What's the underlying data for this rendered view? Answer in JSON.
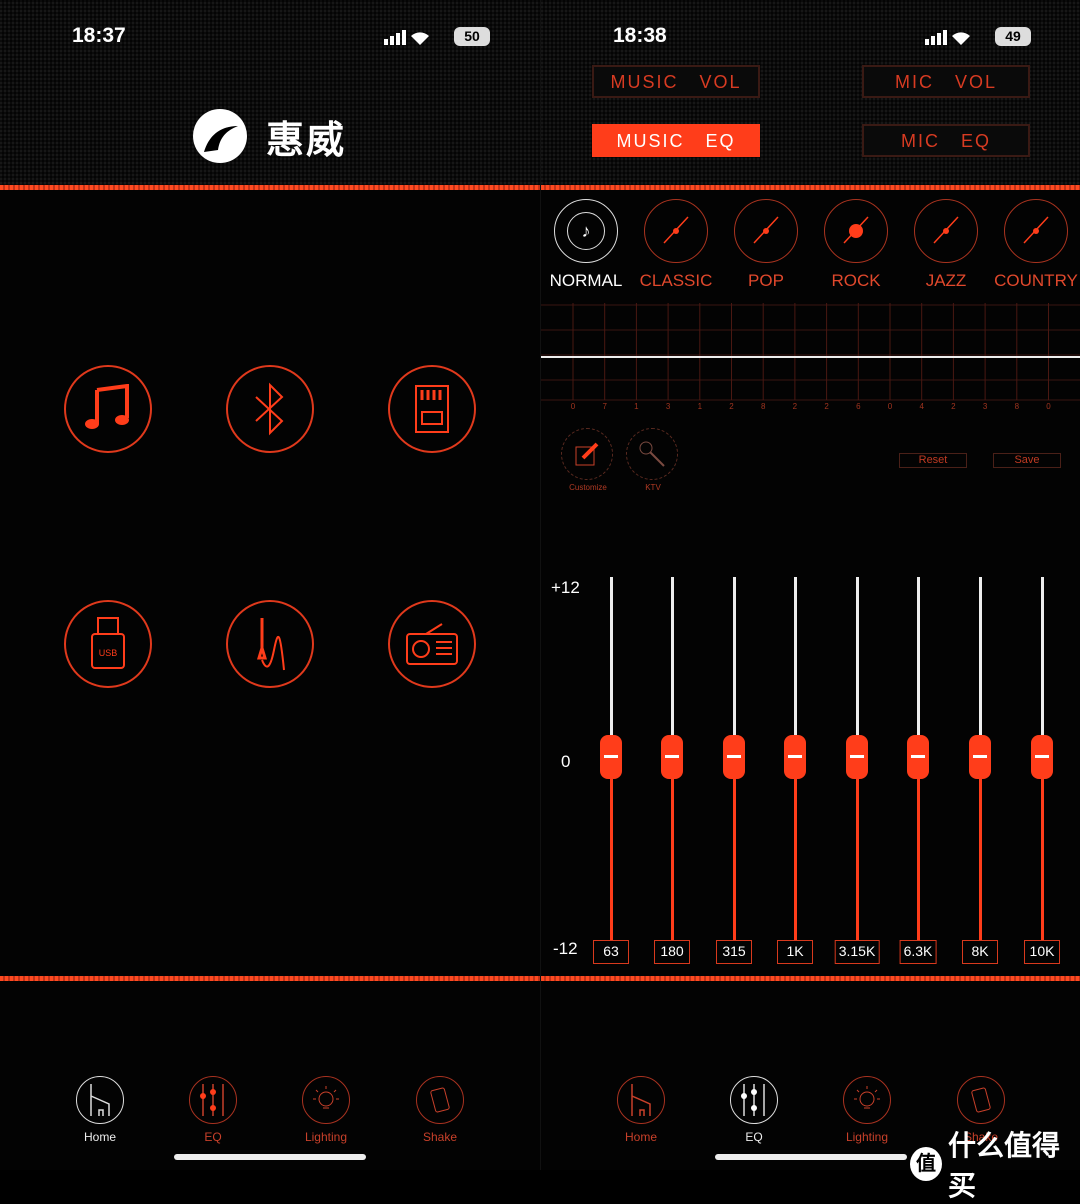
{
  "accent": "#ff3d1a",
  "left": {
    "time": "18:37",
    "battery": "50",
    "brand": "惠威",
    "sources": [
      "music-note-icon",
      "bluetooth-icon",
      "sd-card-icon",
      "usb-icon",
      "aux-cable-icon",
      "radio-icon"
    ],
    "usb_label": "USB",
    "nav": [
      {
        "label": "Home",
        "active": true
      },
      {
        "label": "EQ"
      },
      {
        "label": "Lighting"
      },
      {
        "label": "Shake"
      }
    ]
  },
  "right": {
    "time": "18:38",
    "battery": "49",
    "buttons": {
      "music_vol": "MUSIC VOL",
      "mic_vol": "MIC VOL",
      "music_eq": "MUSIC EQ",
      "mic_eq": "MIC EQ"
    },
    "presets": [
      {
        "label": "NORMAL",
        "active": true
      },
      {
        "label": "CLASSIC"
      },
      {
        "label": "POP"
      },
      {
        "label": "ROCK"
      },
      {
        "label": "JAZZ"
      },
      {
        "label": "COUNTRY"
      }
    ],
    "grid_labels": [
      "0",
      "7",
      "1",
      "3",
      "1",
      "2",
      "8",
      "2",
      "2",
      "6",
      "0",
      "4",
      "2",
      "3",
      "8",
      "0"
    ],
    "tools": [
      "Customize",
      "KTV"
    ],
    "reset": "Reset",
    "save": "Save",
    "axis": {
      "max": "+12",
      "mid": "0",
      "min": "-12"
    },
    "bands": [
      {
        "freq": "63",
        "gain": 0
      },
      {
        "freq": "180",
        "gain": 0
      },
      {
        "freq": "315",
        "gain": 0
      },
      {
        "freq": "1K",
        "gain": 0
      },
      {
        "freq": "3.15K",
        "gain": 0
      },
      {
        "freq": "6.3K",
        "gain": 0
      },
      {
        "freq": "8K",
        "gain": 0
      },
      {
        "freq": "10K",
        "gain": 0
      }
    ],
    "nav": [
      {
        "label": "Home"
      },
      {
        "label": "EQ",
        "active": true
      },
      {
        "label": "Lighting"
      },
      {
        "label": "Shake"
      }
    ]
  },
  "watermark": "什么值得买"
}
